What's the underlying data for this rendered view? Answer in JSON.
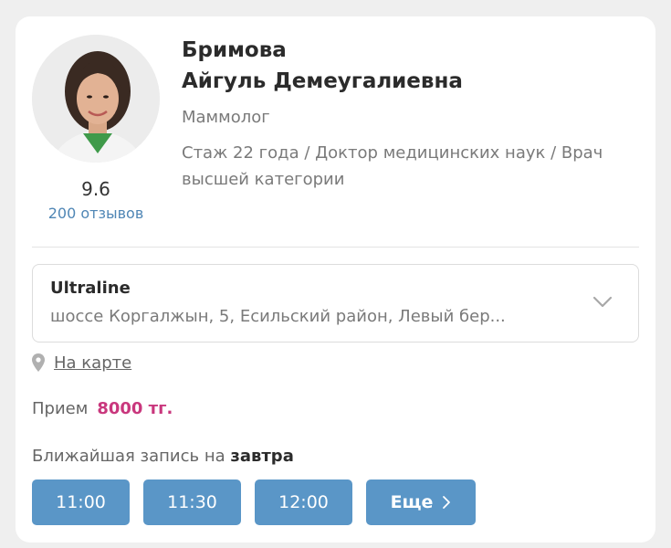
{
  "doctor": {
    "last_name": "Бримова",
    "first_names": "Айгуль Демеугалиевна",
    "specialty": "Маммолог",
    "experience": "Стаж 22 года / Доктор медицинских наук / Врач высшей категории",
    "rating": "9.6",
    "reviews": "200 отзывов"
  },
  "clinic": {
    "name": "Ultraline",
    "address": "шоссе Коргалжын, 5, Есильский район, Левый бер..."
  },
  "map_link": "На карте",
  "price": {
    "label": "Прием",
    "value": "8000 тг."
  },
  "nearest": {
    "label": "Ближайшая запись на ",
    "day": "завтра"
  },
  "slots": [
    "11:00",
    "11:30",
    "12:00"
  ],
  "more_label": "Еще",
  "colors": {
    "accent": "#5a96c7",
    "price": "#c9377d",
    "link": "#4f86b5"
  },
  "icons": {
    "pin": "map-pin-icon",
    "chevron": "chevron-down-icon",
    "arrow": "chevron-right-icon"
  }
}
